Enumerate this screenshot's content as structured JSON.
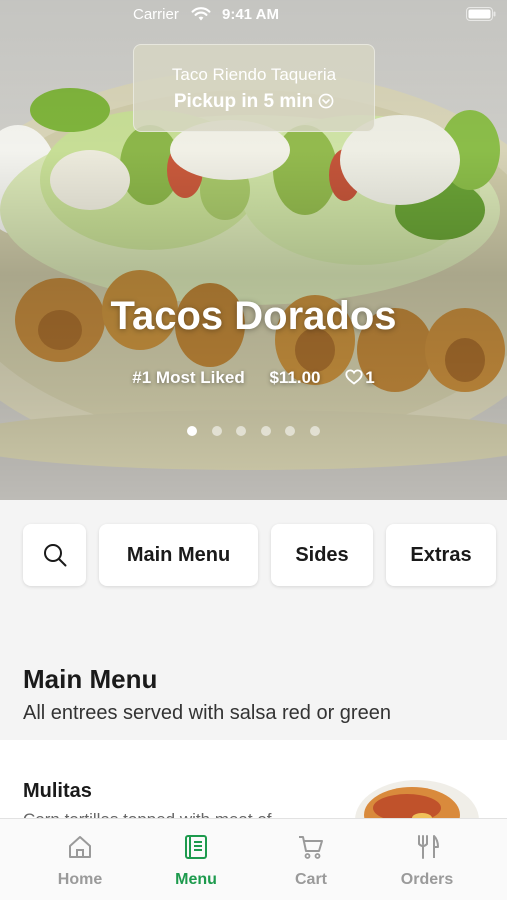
{
  "status_bar": {
    "carrier": "Carrier",
    "time": "9:41 AM"
  },
  "pickup": {
    "restaurant": "Taco Riendo Taqueria",
    "eta": "Pickup in 5 min"
  },
  "featured": {
    "title": "Tacos Dorados",
    "badge": "#1 Most Liked",
    "price": "$11.00",
    "likes": "1",
    "carousel_count": 6,
    "carousel_active": 1
  },
  "categories": {
    "search_icon": "search-icon",
    "items": [
      "Main Menu",
      "Sides",
      "Extras"
    ]
  },
  "section": {
    "title": "Main Menu",
    "subtitle": "All entrees served with salsa red or green"
  },
  "menu_items": [
    {
      "name": "Mulitas",
      "description": "Corn tortillas topped with meat of"
    }
  ],
  "tabs": [
    {
      "label": "Home",
      "icon": "home-icon",
      "active": false
    },
    {
      "label": "Menu",
      "icon": "menu-book-icon",
      "active": true
    },
    {
      "label": "Cart",
      "icon": "cart-icon",
      "active": false
    },
    {
      "label": "Orders",
      "icon": "fork-knife-icon",
      "active": false
    }
  ],
  "colors": {
    "accent": "#1d9a4d",
    "inactive_tab": "#9a9a9a",
    "background": "#f4f4f4"
  }
}
